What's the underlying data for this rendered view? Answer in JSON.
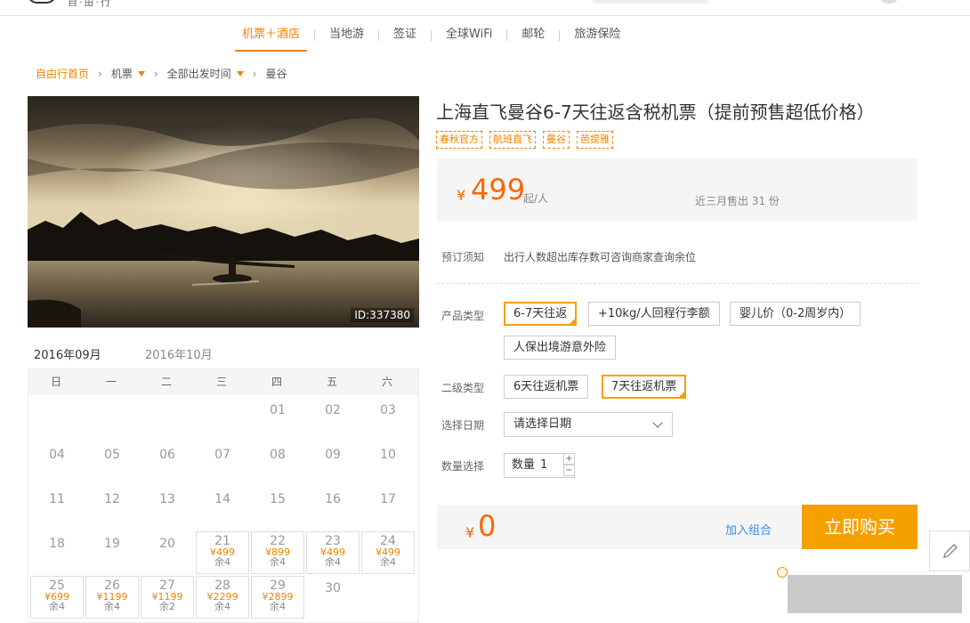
{
  "topbar": {
    "logo_text": "自·由·行"
  },
  "nav": {
    "items": [
      {
        "label": "机票＋酒店",
        "active": true
      },
      {
        "label": "当地游"
      },
      {
        "label": "签证"
      },
      {
        "label": "全球WiFi"
      },
      {
        "label": "邮轮"
      },
      {
        "label": "旅游保险"
      }
    ]
  },
  "breadcrumb": {
    "home": "自由行首页",
    "level1": "机票",
    "level2": "全部出发时间",
    "level3": "曼谷"
  },
  "hero": {
    "image_id": "ID:337380"
  },
  "calendar": {
    "tabs": [
      "2016年09月",
      "2016年10月"
    ],
    "weekdays": [
      "日",
      "一",
      "二",
      "三",
      "四",
      "五",
      "六"
    ],
    "cells": [
      {
        "d": "01",
        "p": "",
        "s": ""
      },
      {
        "d": "02",
        "p": "",
        "s": ""
      },
      {
        "d": "03",
        "p": "",
        "s": ""
      },
      {
        "d": "04",
        "p": "",
        "s": ""
      },
      {
        "d": "05",
        "p": "",
        "s": ""
      },
      {
        "d": "06",
        "p": "",
        "s": ""
      },
      {
        "d": "07",
        "p": "",
        "s": ""
      },
      {
        "d": "08",
        "p": "",
        "s": ""
      },
      {
        "d": "09",
        "p": "",
        "s": ""
      },
      {
        "d": "10",
        "p": "",
        "s": ""
      },
      {
        "d": "11",
        "p": "",
        "s": ""
      },
      {
        "d": "12",
        "p": "",
        "s": ""
      },
      {
        "d": "13",
        "p": "",
        "s": ""
      },
      {
        "d": "14",
        "p": "",
        "s": ""
      },
      {
        "d": "15",
        "p": "",
        "s": ""
      },
      {
        "d": "16",
        "p": "",
        "s": ""
      },
      {
        "d": "17",
        "p": "",
        "s": ""
      },
      {
        "d": "18",
        "p": "",
        "s": ""
      },
      {
        "d": "19",
        "p": "",
        "s": ""
      },
      {
        "d": "20",
        "p": "",
        "s": ""
      },
      {
        "d": "21",
        "p": "¥499",
        "s": "余4"
      },
      {
        "d": "22",
        "p": "¥899",
        "s": "余4"
      },
      {
        "d": "23",
        "p": "¥499",
        "s": "余4"
      },
      {
        "d": "24",
        "p": "¥499",
        "s": "余4"
      },
      {
        "d": "25",
        "p": "¥699",
        "s": "余4"
      },
      {
        "d": "26",
        "p": "¥1199",
        "s": "余4"
      },
      {
        "d": "27",
        "p": "¥1199",
        "s": "余2"
      },
      {
        "d": "28",
        "p": "¥2299",
        "s": "余4"
      },
      {
        "d": "29",
        "p": "¥2899",
        "s": "余4"
      },
      {
        "d": "30",
        "p": "",
        "s": ""
      }
    ]
  },
  "product": {
    "title": "上海直飞曼谷6-7天往返含税机票（提前预售超低价格）",
    "tags": [
      "春秋官方",
      "航班直飞",
      "曼谷",
      "芭提雅"
    ],
    "price_currency": "¥",
    "price": "499",
    "price_unit": "起/人",
    "sold": "近三月售出 31 份"
  },
  "form": {
    "notice_label": "预订须知",
    "notice_text": "出行人数超出库存数可咨询商家查询余位",
    "type_label": "产品类型",
    "type_options": [
      "6-7天往返",
      "+10kg/人回程行李额",
      "婴儿价（0-2周岁内）",
      "人保出境游意外险"
    ],
    "subtype_label": "二级类型",
    "subtype_options": [
      "6天往返机票",
      "7天往返机票"
    ],
    "date_label": "选择日期",
    "date_placeholder": "请选择日期",
    "qty_label": "数量选择",
    "qty_text": "数量",
    "qty_value": "1",
    "qty_plus": "+",
    "qty_minus": "−"
  },
  "buybar": {
    "currency": "¥",
    "total": "0",
    "combo": "加入组合",
    "buy": "立即购买"
  },
  "colors": {
    "accent": "#f08200",
    "buy_button": "#f6a000",
    "link": "#3a8ee6"
  }
}
